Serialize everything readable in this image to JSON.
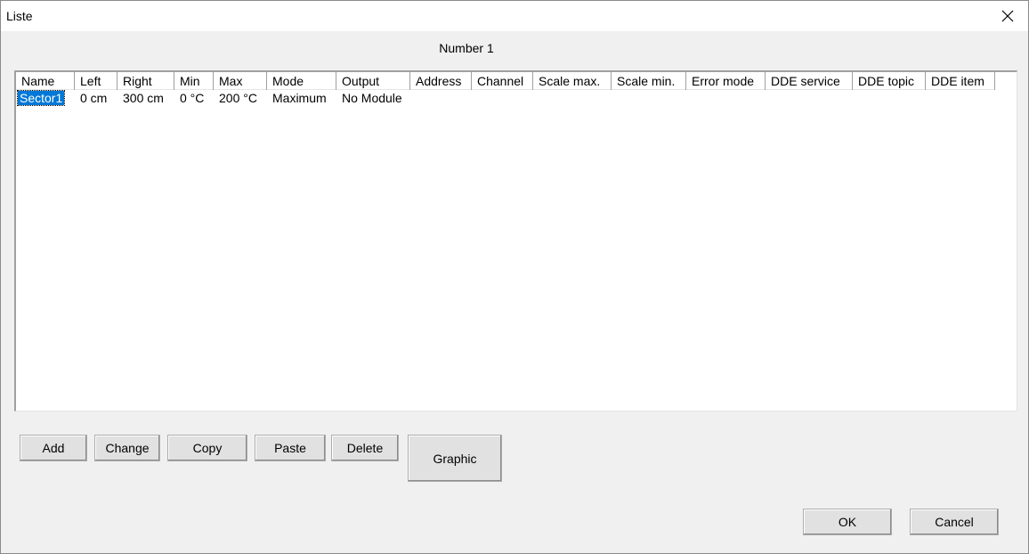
{
  "window": {
    "title": "Liste"
  },
  "number_label": "Number  1",
  "list": {
    "columns": [
      "Name",
      "Left",
      "Right",
      "Min",
      "Max",
      "Mode",
      "Output",
      "Address",
      "Channel",
      "Scale max.",
      "Scale min.",
      "Error mode",
      "DDE service",
      "DDE topic",
      "DDE item"
    ],
    "rows": [
      [
        "Sector1",
        "0 cm",
        "300 cm",
        "0 °C",
        "200 °C",
        "Maximum",
        "No Module",
        "",
        "",
        "",
        "",
        "",
        "",
        "",
        ""
      ]
    ],
    "selected_row": 0
  },
  "buttons": {
    "add": "Add",
    "change": "Change",
    "copy": "Copy",
    "paste": "Paste",
    "delete": "Delete",
    "graphic": "Graphic",
    "ok": "OK",
    "cancel": "Cancel"
  },
  "icons": {
    "close": "close-icon"
  },
  "colors": {
    "selection": "#0078d7",
    "window_bg": "#f0f0f0"
  }
}
